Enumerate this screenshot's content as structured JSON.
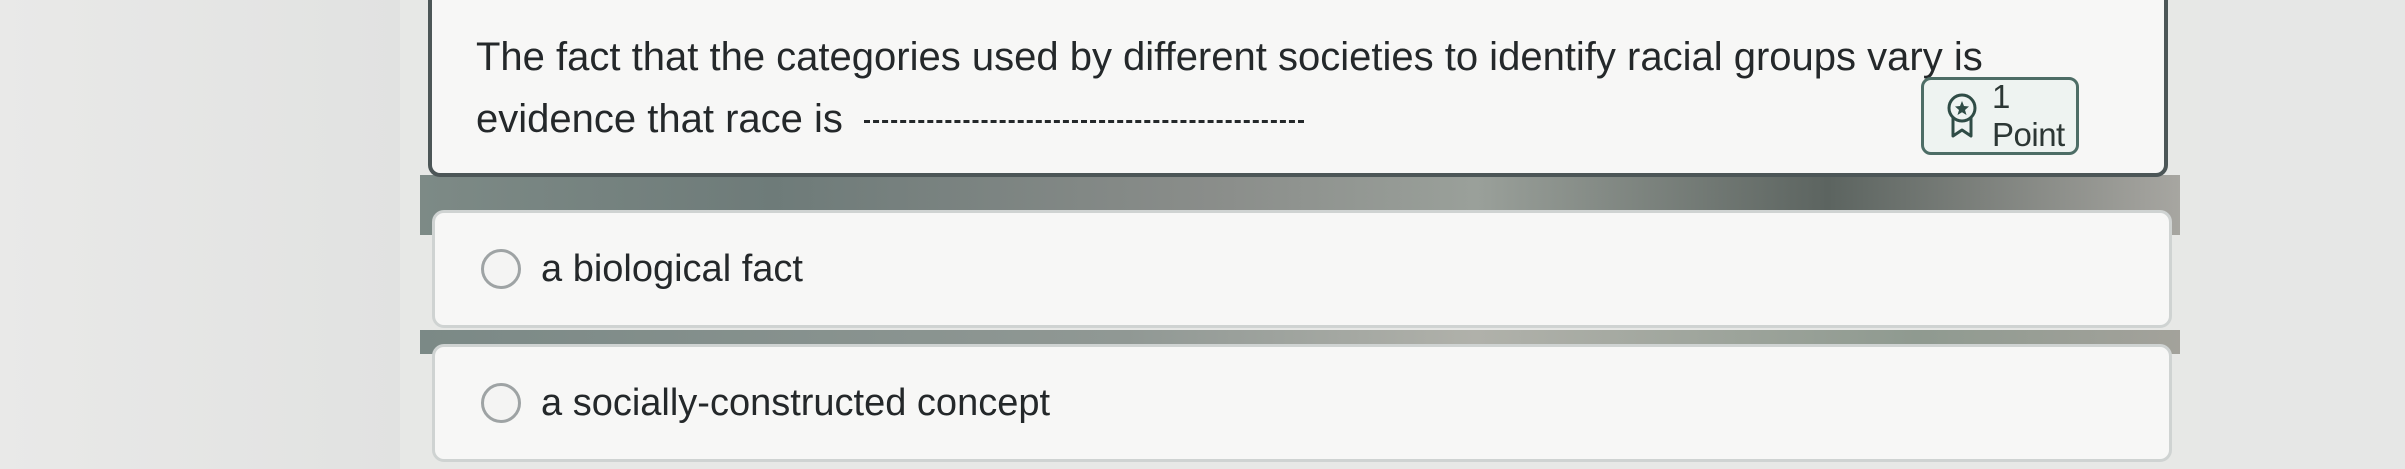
{
  "question": {
    "text": "The fact that the categories used by different societies to identify racial groups vary is evidence that race is",
    "points_label": "1 Point",
    "points_icon": "award-icon"
  },
  "options": [
    {
      "label": "a biological fact",
      "selected": false
    },
    {
      "label": "a socially-constructed concept",
      "selected": false
    }
  ],
  "colors": {
    "card_border": "#4c5657",
    "badge_border": "#4d6d66",
    "text": "#24282a"
  }
}
